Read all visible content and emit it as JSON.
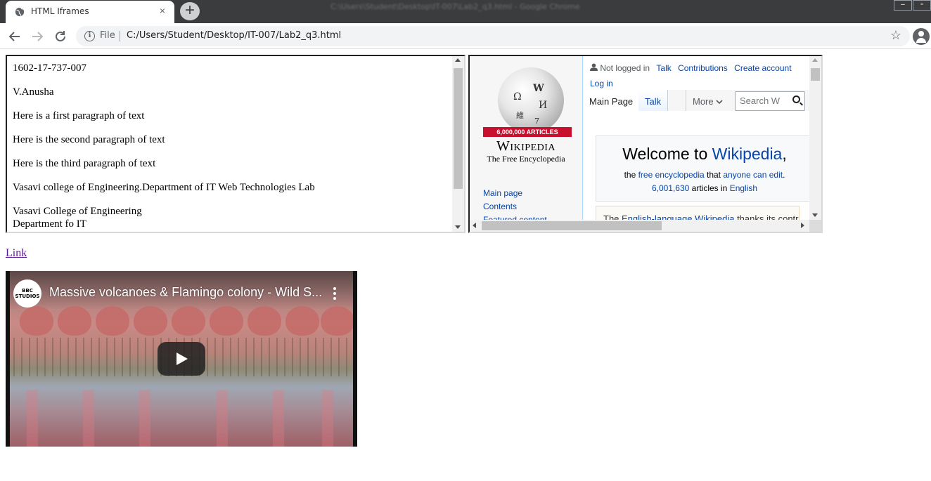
{
  "browser": {
    "window_title": "C:\\Users\\Student\\Desktop\\IT-007\\Lab2_q3.html - Google Chrome",
    "tab_title": "HTML Iframes",
    "tab_close": "×",
    "new_tab": "+",
    "window_controls": [
      "–",
      "▫"
    ],
    "address_scheme_label": "File",
    "address_url": "C:/Users/Student/Desktop/IT-007/Lab2_q3.html"
  },
  "iframe1": {
    "paragraphs": [
      "1602-17-737-007",
      "V.Anusha",
      "Here is a first paragraph of text",
      "Here is the second paragraph of text",
      "Here is the third paragraph of text",
      "Vasavi college of Engineering.Department of IT Web Technologies Lab"
    ],
    "address_line1": "Vasavi College of Engineering",
    "address_line2": "Department fo IT",
    "scroll_fraction": 0.0
  },
  "wikipedia": {
    "banner": "6,000,000 ARTICLES",
    "wordmark": "Wikipedia",
    "tagline": "The Free Encyclopedia",
    "globe_glyphs": [
      "Ω",
      "W",
      "И",
      "維",
      "7"
    ],
    "user_links": {
      "not_logged_in": "Not logged in",
      "talk": "Talk",
      "contributions": "Contributions",
      "create_account": "Create account",
      "log_in": "Log in"
    },
    "tabs": {
      "main_page": "Main Page",
      "talk": "Talk",
      "more": "More"
    },
    "search_placeholder": "Search W",
    "nav": [
      "Main page",
      "Contents",
      "Featured content"
    ],
    "welcome": {
      "welcome_to": "Welcome to ",
      "wikipedia": "Wikipedia",
      "comma": ",",
      "the": "the ",
      "free_encyclopedia": "free encyclopedia",
      "that": " that ",
      "anyone_can_edit": "anyone can edit",
      "period": ".",
      "article_count": "6,001,630",
      "articles_in": " articles in ",
      "english": "English"
    },
    "next_box": {
      "the": "The ",
      "link": "English-language Wikipedia",
      "rest": " thanks its contr"
    }
  },
  "link_text": "Link",
  "video": {
    "channel_badge": "BBC STUDIOS",
    "title": "Massive volcanoes & Flamingo colony - Wild S..."
  },
  "colors": {
    "link_blue": "#0645ad",
    "visited_link": "#551a8b",
    "wiki_banner": "#c8102e",
    "chrome_titlebar": "#3b3c3e"
  },
  "icons": [
    "globe-favicon-icon",
    "back-arrow-icon",
    "forward-arrow-icon",
    "reload-icon",
    "info-icon",
    "star-icon",
    "profile-icon",
    "user-icon",
    "search-icon",
    "chevron-down-icon",
    "play-icon",
    "more-vert-icon"
  ]
}
